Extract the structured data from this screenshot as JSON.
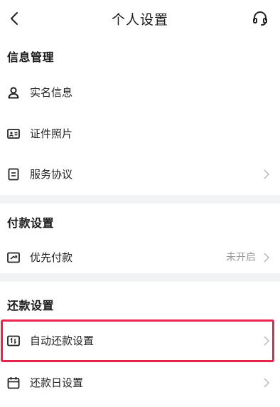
{
  "header": {
    "title": "个人设置",
    "back_icon": "chevron-left-icon",
    "support_icon": "headset-icon"
  },
  "sections": [
    {
      "title": "信息管理",
      "items": [
        {
          "label": "实名信息",
          "icon": "user-icon"
        },
        {
          "label": "证件照片",
          "icon": "id-card-icon"
        },
        {
          "label": "服务协议",
          "icon": "document-icon"
        }
      ]
    },
    {
      "title": "付款设置",
      "items": [
        {
          "label": "优先付款",
          "value": "未开启",
          "icon": "priority-pay-icon"
        }
      ]
    },
    {
      "title": "还款设置",
      "items": [
        {
          "label": "自动还款设置",
          "icon": "auto-repay-icon"
        },
        {
          "label": "还款日设置",
          "icon": "calendar-icon"
        }
      ]
    }
  ],
  "colors": {
    "highlight": "#e8244f",
    "chevron": "#b8b8b8",
    "icon": "#222222"
  }
}
